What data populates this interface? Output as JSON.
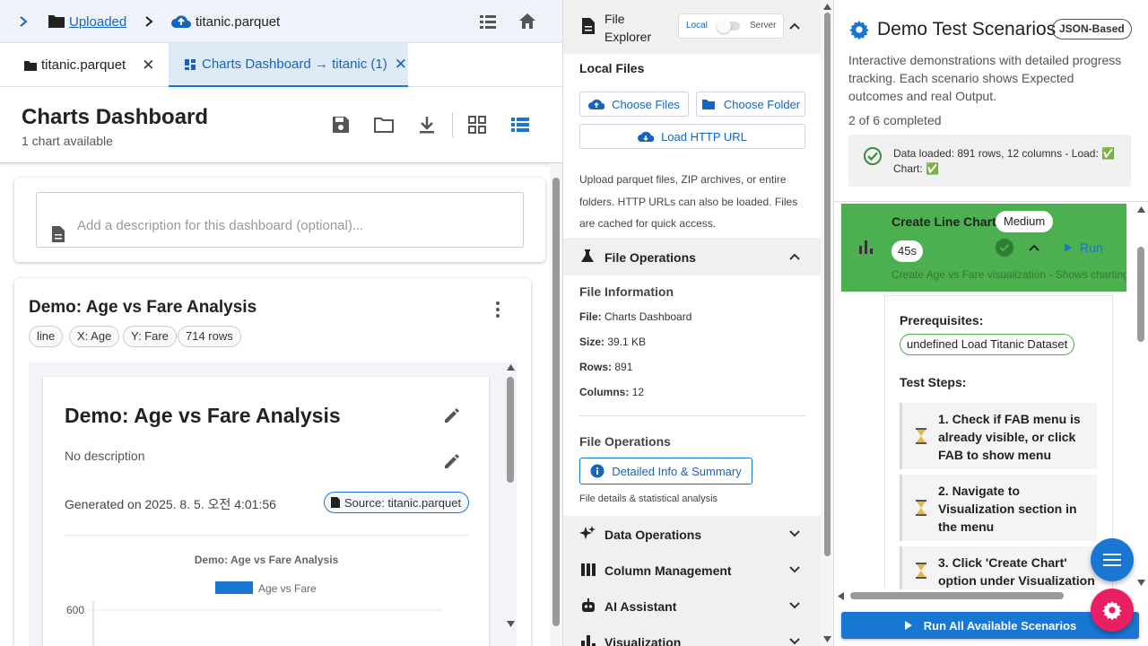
{
  "left": {
    "breadcrumb": {
      "folder": "Uploaded",
      "file": "titanic.parquet"
    },
    "tabs": [
      {
        "label": "titanic.parquet",
        "close": "✕"
      },
      {
        "label": "Charts Dashboard → titanic (1)",
        "close": "✕"
      }
    ],
    "dashboard": {
      "title": "Charts Dashboard",
      "subtitle": "1 chart available"
    },
    "description_placeholder": "Add a description for this dashboard (optional)...",
    "chart_card": {
      "title": "Demo: Age vs Fare Analysis",
      "chips": [
        "line",
        "X: Age",
        "Y: Fare",
        "714 rows"
      ],
      "inner_title": "Demo: Age vs Fare Analysis",
      "inner_desc": "No description",
      "generated": "Generated on 2025. 8. 5. 오전 4:01:56",
      "source": "Source: titanic.parquet"
    }
  },
  "chart_data": {
    "type": "line",
    "title": "Demo: Age vs Fare Analysis",
    "legend": [
      "Age vs Fare"
    ],
    "series": [
      {
        "name": "Age vs Fare",
        "color": "#1976d2",
        "values": []
      }
    ],
    "y_ticks": [
      "600"
    ],
    "legend_position": "top"
  },
  "middle": {
    "explorer": {
      "title_line1": "File",
      "title_line2": "Explorer",
      "toggle_left": "Local",
      "toggle_right": "Server"
    },
    "local_files": {
      "title": "Local Files",
      "choose_files": "Choose Files",
      "choose_folder": "Choose Folder",
      "load_http": "Load HTTP URL",
      "help": "Upload parquet files, ZIP archives, or entire folders. HTTP URLs can also be loaded. Files are cached for quick access."
    },
    "file_operations": {
      "title": "File Operations",
      "info_title": "File Information",
      "file_label": "File:",
      "file_value": "Charts Dashboard",
      "size_label": "Size:",
      "size_value": "39.1 KB",
      "rows_label": "Rows:",
      "rows_value": "891",
      "cols_label": "Columns:",
      "cols_value": "12",
      "ops_title": "File Operations",
      "detail_button": "Detailed Info & Summary",
      "detail_caption": "File details & statistical analysis"
    },
    "sections": [
      "Data Operations",
      "Column Management",
      "AI Assistant",
      "Visualization"
    ]
  },
  "right": {
    "title": "Demo Test Scenarios",
    "badge": "JSON-Based",
    "intro": "Interactive demonstrations with detailed progress tracking. Each scenario shows Expected outcomes and real Output.",
    "progress": "2 of 6 completed",
    "status": "Data loaded: 891 rows, 12 columns - Load: ✅ Chart: ✅",
    "scenario": {
      "title": "Create Line Chart",
      "difficulty": "Medium",
      "duration": "45s",
      "run": "Run",
      "subtitle": "Create Age vs Fare visualization - Shows charting capabilities",
      "prereq_title": "Prerequisites:",
      "prereq_chip": "undefined Load Titanic Dataset",
      "steps_title": "Test Steps:",
      "steps": [
        "1. Check if FAB menu is already visible, or click FAB to show menu",
        "2. Navigate to Visualization section in the menu",
        "3. Click 'Create Chart' option under Visualization"
      ]
    },
    "run_all": "Run All Available Scenarios",
    "colors": {
      "accent": "#1976d2",
      "success": "#4caf50",
      "fab_red": "#e91e63"
    }
  }
}
